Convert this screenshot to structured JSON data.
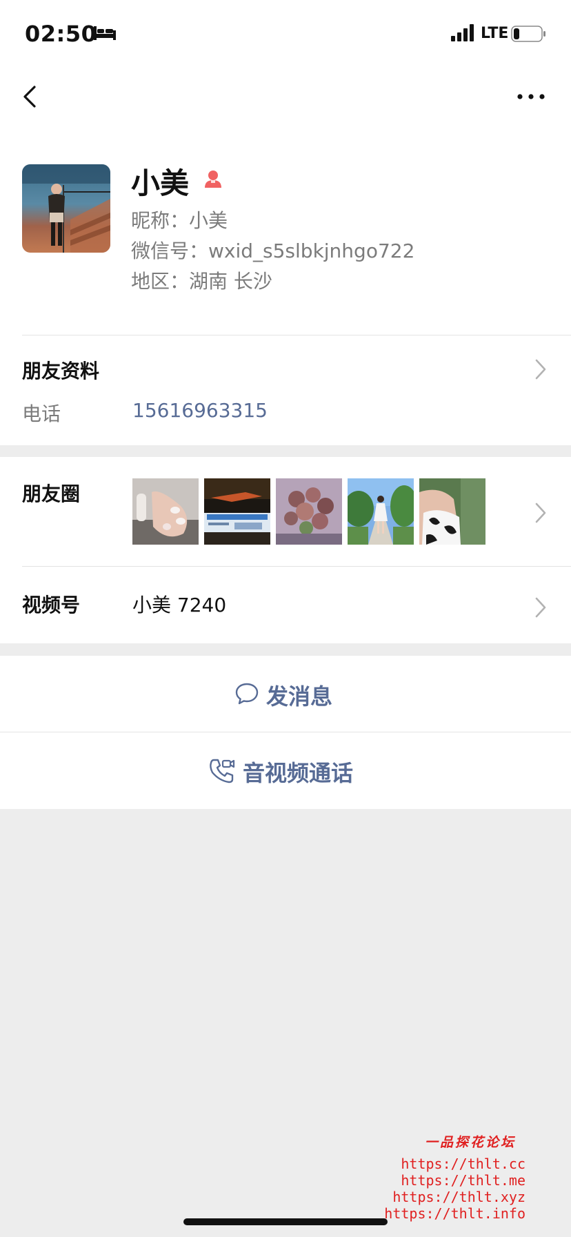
{
  "status_bar": {
    "time": "02:50",
    "network": "LTE",
    "icons": [
      "bed-icon",
      "signal-icon",
      "battery-icon"
    ]
  },
  "nav": {
    "back_icon": "chevron-left-icon",
    "more_icon": "more-horizontal-icon"
  },
  "profile": {
    "name": "小美",
    "gender_icon": "female-icon",
    "nickname_line": "昵称：小美",
    "wechat_id_line": "微信号：wxid_s5slbkjnhgo722",
    "region_line": "地区：湖南 长沙"
  },
  "friend_info": {
    "title": "朋友资料",
    "phone_label": "电话",
    "phone_value": "15616963315"
  },
  "moments": {
    "title": "朋友圈",
    "thumbnail_count": 5
  },
  "channels": {
    "title": "视频号",
    "value": "小美 7240"
  },
  "actions": {
    "message_label": "发消息",
    "call_label": "音视频通话"
  },
  "watermark": {
    "title": "一品探花论坛",
    "links": [
      "https://thlt.cc",
      "https://thlt.me",
      "https://thlt.xyz",
      "https://thlt.info"
    ]
  },
  "colors": {
    "link_blue": "#576b95",
    "gender_red": "#f06262",
    "watermark_red": "#e02020",
    "page_bg": "#ededed"
  }
}
